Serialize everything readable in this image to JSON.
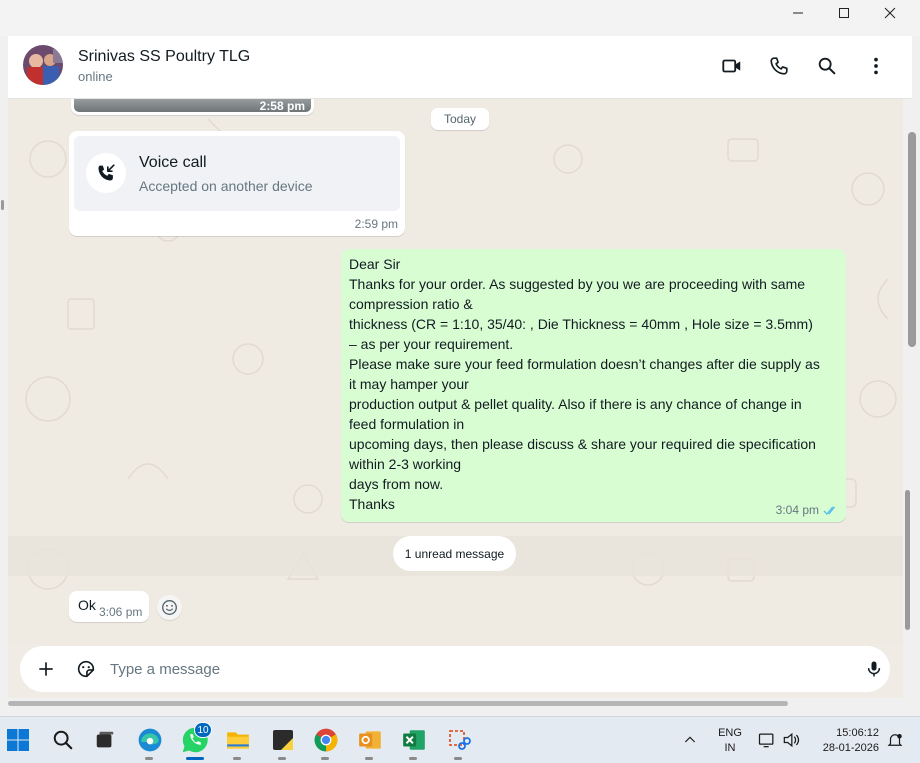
{
  "window": {
    "minimize_icon": "minimize-icon",
    "maximize_icon": "maximize-icon",
    "close_icon": "close-icon"
  },
  "header": {
    "contact_name": "Srinivas SS Poultry TLG",
    "status": "online",
    "actions": [
      "video-call-icon",
      "voice-call-icon",
      "search-icon",
      "more-options-icon"
    ]
  },
  "chat": {
    "image_time": "2:58 pm",
    "date_chip": "Today",
    "voice_call": {
      "title": "Voice call",
      "subtitle": "Accepted on another device",
      "time": "2:59 pm"
    },
    "outgoing_message": {
      "lines": [
        "Dear Sir",
        "Thanks for your order. As suggested by you we are proceeding with same",
        "compression ratio &",
        "thickness (CR = 1:10,  35/40:  , Die Thickness = 40mm , Hole size = 3.5mm)",
        "– as per your requirement.",
        "Please make sure your feed formulation doesn’t changes after die supply as",
        "it may hamper your",
        "production output & pellet quality. Also if there is any chance of change in",
        "feed formulation in",
        "upcoming days, then please discuss & share your required die specification",
        "within 2-3 working",
        "days from now.",
        "Thanks"
      ],
      "time": "3:04 pm",
      "status_icon": "double-tick-read-icon"
    },
    "unread_label": "1 unread message",
    "incoming_message": {
      "text": "Ok",
      "time": "3:06 pm"
    }
  },
  "composer": {
    "placeholder": "Type a message",
    "value": ""
  },
  "taskbar": {
    "apps": [
      "windows-start-icon",
      "search-icon",
      "task-view-icon",
      "edge-icon",
      "whatsapp-icon",
      "file-explorer-icon",
      "sticky-notes-icon",
      "chrome-icon",
      "outlook-icon",
      "excel-icon",
      "snipping-tool-icon"
    ],
    "whatsapp_badge": "10",
    "language_line1": "ENG",
    "language_line2": "IN",
    "time": "15:06:12",
    "date": "28-01-2026"
  },
  "colors": {
    "outgoing_bubble": "#d9fdd3",
    "incoming_bubble": "#ffffff",
    "chat_background": "#efeae2",
    "read_tick": "#53bdeb"
  }
}
